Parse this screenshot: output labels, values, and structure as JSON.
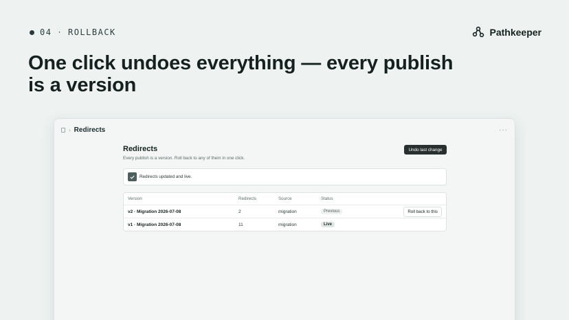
{
  "eyebrow": {
    "number": "04",
    "separator": "·",
    "label": "ROLLBACK"
  },
  "brand": {
    "name": "Pathkeeper"
  },
  "headline": "One click undoes everything — every publish is a version",
  "window": {
    "breadcrumb_title": "Redirects",
    "more_icon": "more-horizontal-icon"
  },
  "page": {
    "title": "Redirects",
    "subtitle": "Every publish is a version. Roll back to any of them in one click.",
    "undo_label": "Undo last change"
  },
  "toast": {
    "message": "Redirects updated and live.",
    "icon": "check-icon"
  },
  "table": {
    "headers": {
      "version": "Version",
      "redirects": "Redirects",
      "source": "Source",
      "status": "Status"
    },
    "rows": [
      {
        "version": "v2 · Migration 2026-07-08",
        "redirects": "2",
        "source": "migration",
        "status": "Previous",
        "action": "Roll back to this"
      },
      {
        "version": "v1 · Migration 2026-07-08",
        "redirects": "11",
        "source": "migration",
        "status": "Live"
      }
    ]
  },
  "colors": {
    "background": "#eef3f2",
    "primary_button": "#27302f",
    "text": "#15201f"
  }
}
